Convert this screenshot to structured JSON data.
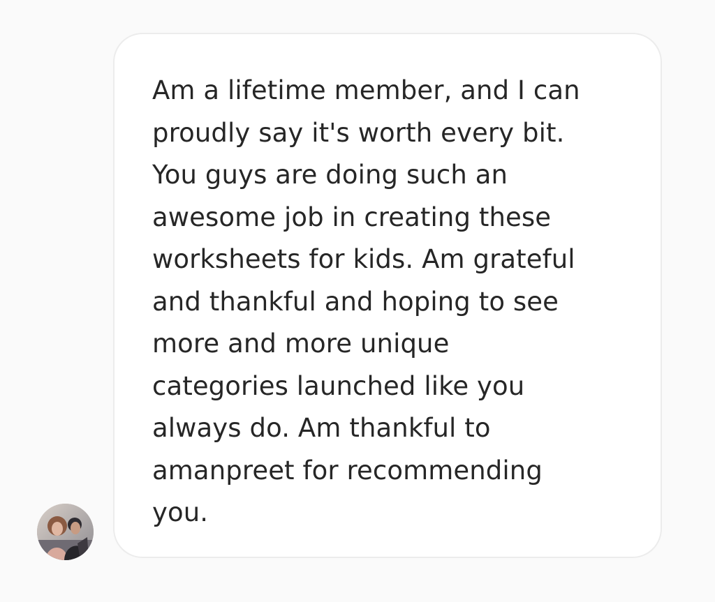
{
  "conversation": {
    "message": {
      "lines": [
        "Am a lifetime member, and I can",
        "proudly say it's worth every bit.",
        "You guys are doing such an",
        "awesome job in creating these",
        "worksheets for kids. Am grateful",
        "and thankful and hoping to see",
        "more and more unique",
        "categories launched like you",
        "always do. Am thankful to",
        "amanpreet for recommending",
        "you."
      ]
    },
    "sender": {
      "avatar_icon": "profile-photo"
    },
    "colors": {
      "background": "#fafafa",
      "bubble_background": "#ffffff",
      "bubble_border": "#ececec",
      "text": "#262626"
    }
  }
}
